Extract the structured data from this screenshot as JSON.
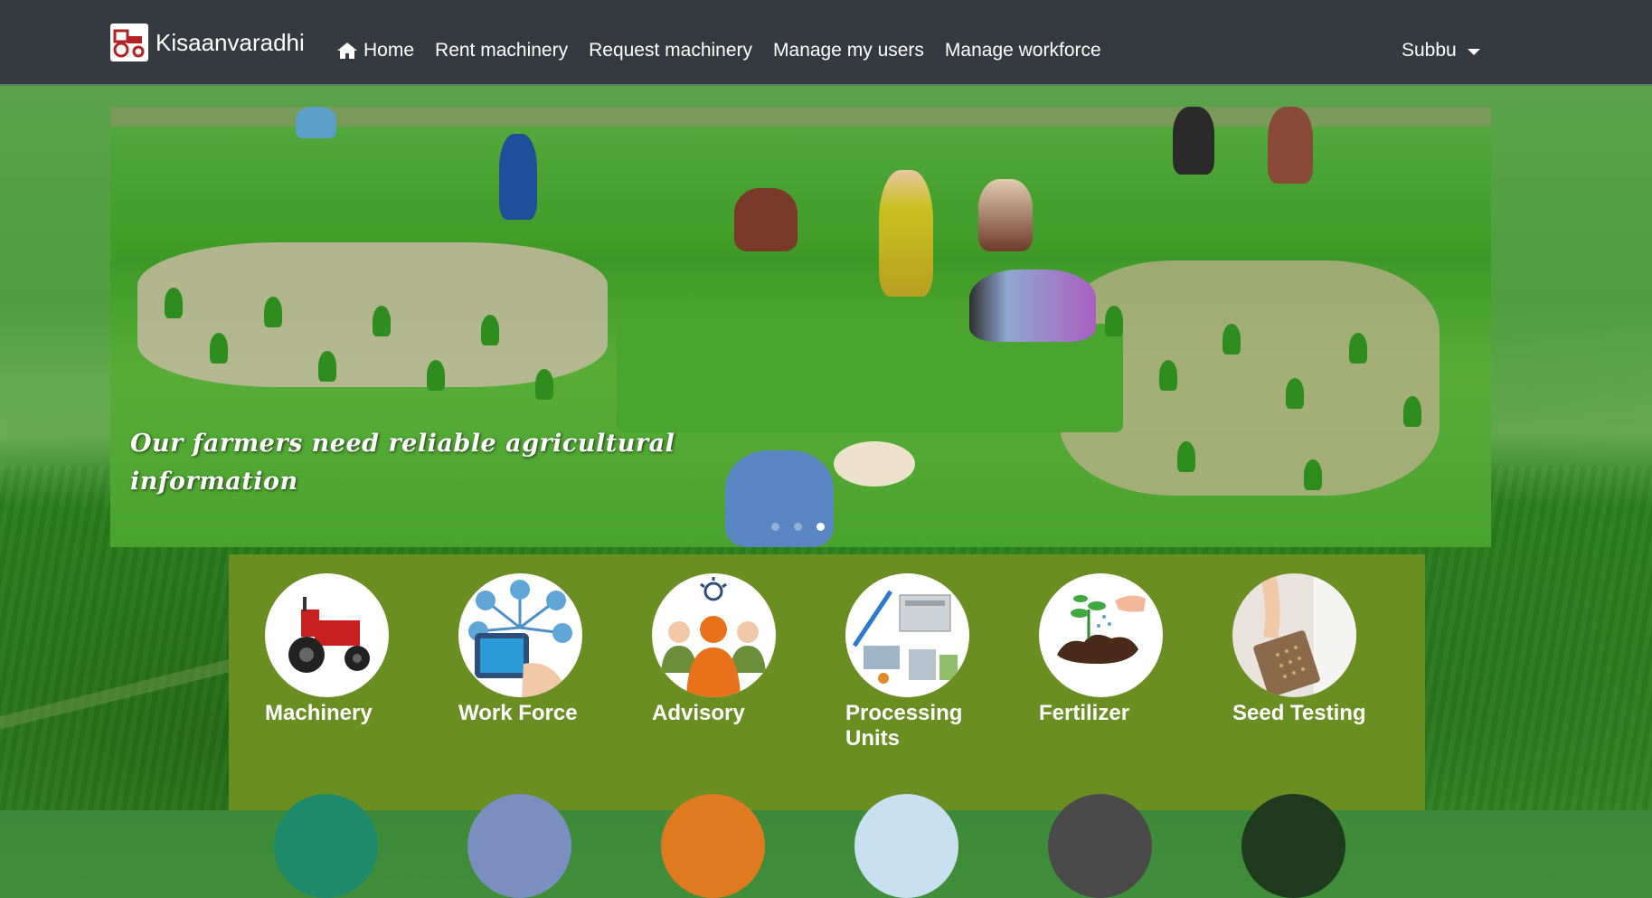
{
  "brand": {
    "name": "Kisaanvaradhi",
    "logo_icon": "tractor-icon"
  },
  "nav": {
    "items": [
      {
        "label": "Home",
        "icon": "home-icon"
      },
      {
        "label": "Rent machinery"
      },
      {
        "label": "Request machinery"
      },
      {
        "label": "Manage my users"
      },
      {
        "label": "Manage workforce"
      }
    ],
    "user": {
      "label": "Subbu"
    }
  },
  "carousel": {
    "caption_line1": "Our farmers need reliable agricultural",
    "caption_line2": "information",
    "slide_count": 3,
    "active_index": 2
  },
  "services": [
    {
      "label": "Machinery",
      "icon": "tractor-icon"
    },
    {
      "label": "Work Force",
      "icon": "network-people-icon"
    },
    {
      "label": "Advisory",
      "icon": "advisor-group-icon"
    },
    {
      "label": "Processing Units",
      "icon": "factory-icon"
    },
    {
      "label": "Fertilizer",
      "icon": "plant-soil-icon"
    },
    {
      "label": "Seed Testing",
      "icon": "seed-tray-icon"
    }
  ],
  "colors": {
    "navbar": "#343a40",
    "panel": "#6b8e23",
    "text": "#ffffff"
  }
}
